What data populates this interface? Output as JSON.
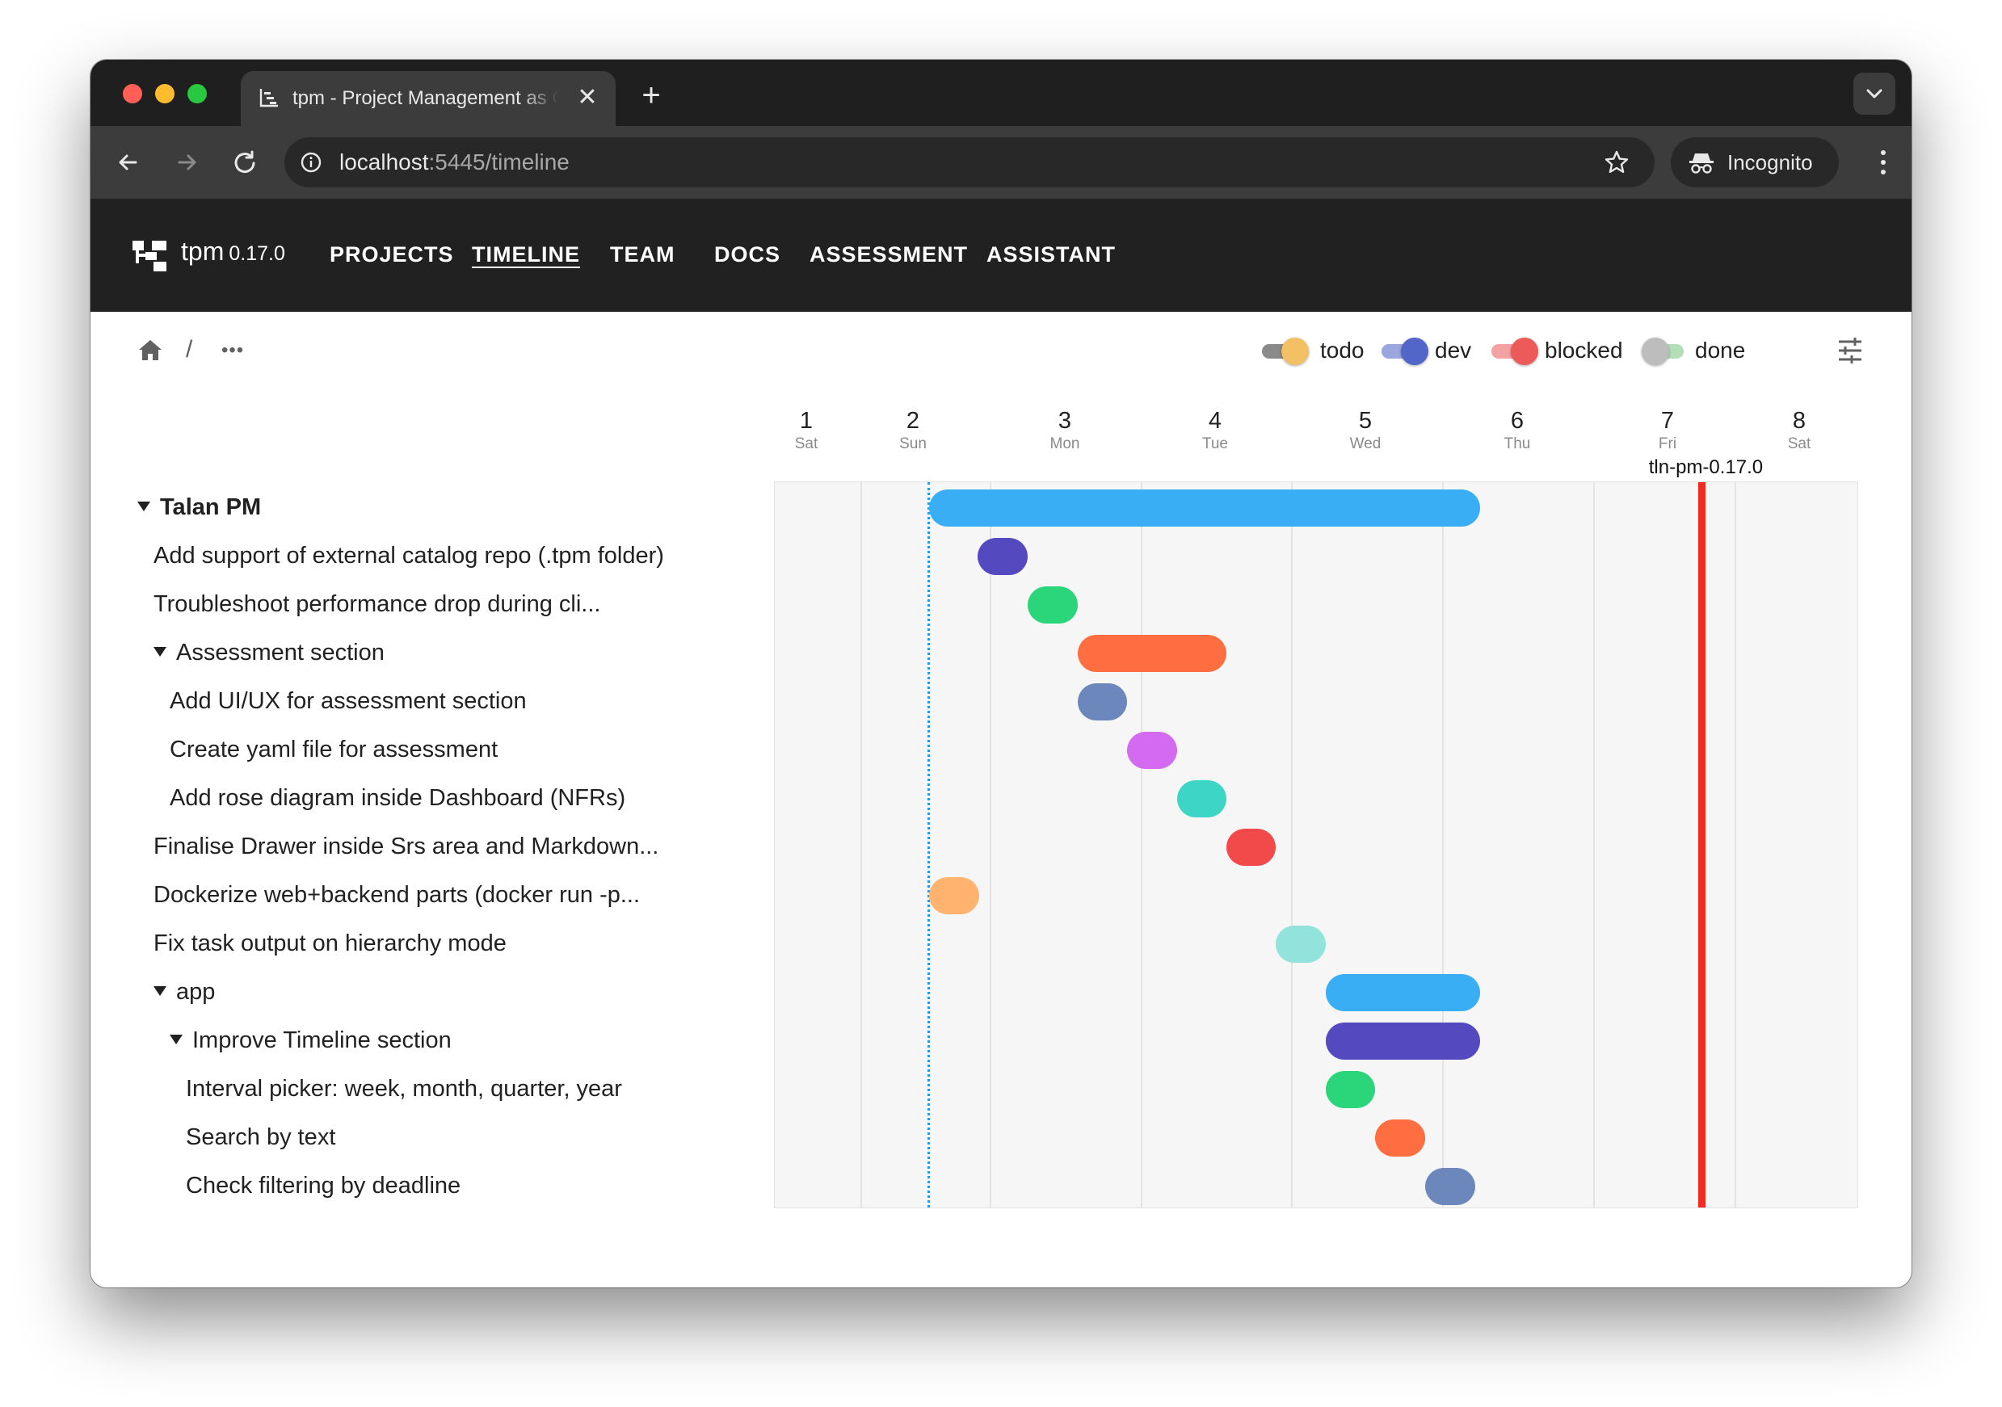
{
  "browser": {
    "tab_title": "tpm - Project Management as Code",
    "tab_close": "✕",
    "new_tab": "+",
    "url_host": "localhost",
    "url_rest": ":5445/timeline",
    "incognito_label": "Incognito"
  },
  "app": {
    "name": "tpm",
    "version": "0.17.0",
    "nav": [
      "PROJECTS",
      "TIMELINE",
      "TEAM",
      "DOCS",
      "ASSESSMENT",
      "ASSISTANT"
    ],
    "active_nav": "TIMELINE"
  },
  "breadcrumb": {
    "separator": "/",
    "more": "•••"
  },
  "legend": [
    {
      "label": "todo",
      "color": "#f4c064",
      "track": "#8a8a8a"
    },
    {
      "label": "dev",
      "color": "#5265c8",
      "track": "#9aa6dd"
    },
    {
      "label": "blocked",
      "color": "#ec5a5a",
      "track": "#f2a2a2"
    },
    {
      "label": "done",
      "color": "#bdbdbd",
      "track": "#b2dfb8"
    }
  ],
  "timeline": {
    "days": [
      {
        "num": "1",
        "name": "Sat"
      },
      {
        "num": "2",
        "name": "Sun"
      },
      {
        "num": "3",
        "name": "Mon"
      },
      {
        "num": "4",
        "name": "Tue"
      },
      {
        "num": "5",
        "name": "Wed"
      },
      {
        "num": "6",
        "name": "Thu"
      },
      {
        "num": "7",
        "name": "Fri"
      },
      {
        "num": "8",
        "name": "Sat"
      }
    ],
    "today_day": 2.1,
    "milestone": {
      "label": "tln-pm-0.17.0",
      "day": 7.25
    }
  },
  "rows": [
    {
      "label": "Talan PM",
      "group": true,
      "level": 0,
      "start": 2.1,
      "end": 5.75,
      "color": "#3aaef5"
    },
    {
      "label": "Add support of external catalog repo (.tpm folder)",
      "group": false,
      "level": 1,
      "start": 2.42,
      "end": 2.75,
      "color": "#5549bf"
    },
    {
      "label": "Troubleshoot performance drop during cli...",
      "group": false,
      "level": 1,
      "start": 2.75,
      "end": 3.08,
      "color": "#2bd67b"
    },
    {
      "label": "Assessment section",
      "group": true,
      "level": 1,
      "start": 3.08,
      "end": 4.07,
      "color": "#ff6e40"
    },
    {
      "label": "Add UI/UX for assessment section",
      "group": false,
      "level": 2,
      "start": 3.08,
      "end": 3.41,
      "color": "#6c87bb"
    },
    {
      "label": "Create yaml file for assessment",
      "group": false,
      "level": 2,
      "start": 3.41,
      "end": 3.74,
      "color": "#d36af0"
    },
    {
      "label": "Add rose diagram inside Dashboard (NFRs)",
      "group": false,
      "level": 2,
      "start": 3.74,
      "end": 4.07,
      "color": "#3dd6c6"
    },
    {
      "label": "Finalise Drawer inside Srs area and Markdown...",
      "group": false,
      "level": 1,
      "start": 4.07,
      "end": 4.4,
      "color": "#f24a4a"
    },
    {
      "label": "Dockerize web+backend parts (docker run -p...",
      "group": false,
      "level": 1,
      "start": 2.1,
      "end": 2.43,
      "color": "#ffb36e"
    },
    {
      "label": "Fix task output on hierarchy mode",
      "group": false,
      "level": 1,
      "start": 4.4,
      "end": 4.73,
      "color": "#92e3dc"
    },
    {
      "label": "app",
      "group": true,
      "level": 1,
      "start": 4.73,
      "end": 5.75,
      "color": "#3aaef5"
    },
    {
      "label": "Improve Timeline section",
      "group": true,
      "level": 2,
      "start": 4.73,
      "end": 5.75,
      "color": "#5549bf"
    },
    {
      "label": "Interval picker: week, month, quarter, year",
      "group": false,
      "level": 3,
      "start": 4.73,
      "end": 5.06,
      "color": "#2bd67b"
    },
    {
      "label": "Search by text",
      "group": false,
      "level": 3,
      "start": 5.06,
      "end": 5.39,
      "color": "#ff6e40"
    },
    {
      "label": "Check filtering by deadline",
      "group": false,
      "level": 3,
      "start": 5.39,
      "end": 5.72,
      "color": "#6c87bb"
    }
  ]
}
